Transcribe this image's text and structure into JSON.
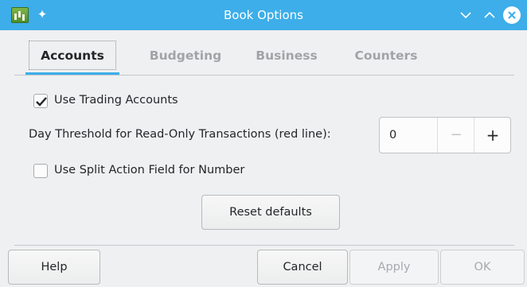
{
  "window": {
    "title": "Book Options",
    "title_bar_color": "#3daee9",
    "icons": [
      "gnucash-app-icon",
      "pin-icon",
      "minimize-icon",
      "maximize-icon",
      "close-icon"
    ]
  },
  "tabs": [
    {
      "label": "Accounts",
      "active": true
    },
    {
      "label": "Budgeting",
      "active": false
    },
    {
      "label": "Business",
      "active": false
    },
    {
      "label": "Counters",
      "active": false
    }
  ],
  "accounts": {
    "use_trading_accounts": {
      "label": "Use Trading Accounts",
      "checked": true
    },
    "day_threshold": {
      "label": "Day Threshold for Read-Only Transactions (red line):",
      "value": "0",
      "minus": "−",
      "plus": "+"
    },
    "use_split_action": {
      "label": "Use Split Action Field for Number",
      "checked": false
    },
    "reset_defaults_label": "Reset defaults"
  },
  "buttons": {
    "help": "Help",
    "cancel": "Cancel",
    "apply": "Apply",
    "ok": "OK"
  },
  "accent_color": "#3daee9"
}
